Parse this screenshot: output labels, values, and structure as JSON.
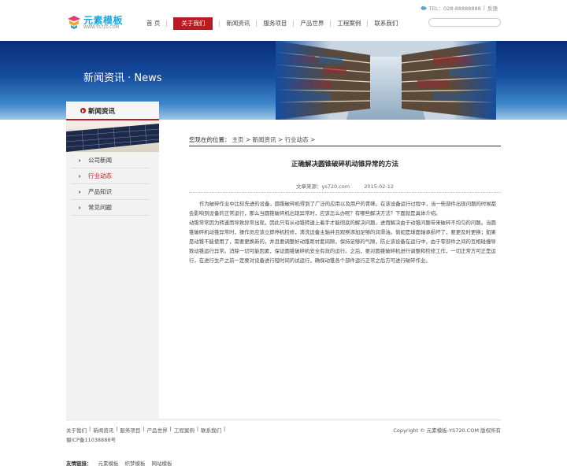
{
  "header": {
    "logo_name": "元素模板",
    "logo_url": "WWW.YS720.COM",
    "tel_text": "TEL：028-88888888",
    "divider": "|",
    "feedback": "反馈",
    "search_placeholder": ""
  },
  "nav": {
    "items": [
      {
        "label": "首 页"
      },
      {
        "label": "关于我们",
        "active": true
      },
      {
        "label": "新闻资讯"
      },
      {
        "label": "服务项目"
      },
      {
        "label": "产品世界"
      },
      {
        "label": "工程案例"
      },
      {
        "label": "联系我们"
      }
    ]
  },
  "banner": {
    "title": "新闻资讯 · News"
  },
  "sidebar": {
    "heading": "新闻资讯",
    "items": [
      {
        "label": "公司新闻"
      },
      {
        "label": "行业动态",
        "active": true
      },
      {
        "label": "产品知识"
      },
      {
        "label": "常见问题"
      }
    ]
  },
  "breadcrumb": {
    "label": "您现在的位置：",
    "path": "主页 > 新闻资讯 > 行业动态 >"
  },
  "article": {
    "title": "正确解决圆锥破碎机动锥异常的方法",
    "source": "文章来源：ys720.com",
    "date": "2015-02-12",
    "para1": "作为破碎作业中比较先进的设备，圆锥破碎机得到了广泛的应用以及用户的青睐。在该设备运行过程中，当一些部件出现问题的时候都会影响到设备的正常运行，那么当圆锥破碎机出现异常时，应该怎么办呢？有哪些解决方法？下面就是具体介绍。",
    "para2": "动锥常常因为转速而导致异常出现，因此只有从动锥转速上着手才能彻底的解决问题，进而解决由于动锥问题带来破碎不均匀的问题。当圆锥破碎机动锥异常时，操作员应该立即停机检修，清洗设备主轴并且观察添加足够的润滑油。倘如是球面轴承损坏了，要更及时更换；如果是动锥不能使用了，需要更换新的，并且要调整好动锥距衬套间隙，保持足够的气隙，防止该设备在运行中，由于零部件之间的互相碰撞导致动锥运行异常。消除一切可能因素，保证圆锥破碎机安全有效的运行。之后，要对圆锥破碎机进行调整和检修工作，一切正常方可正是运行，在进行生产之前一定要对设备进行短时间的试运行，确保动锥各个部件运行正常之后方可进行破碎作业。"
  },
  "footer": {
    "links": [
      "关于我们",
      "新闻资讯",
      "服务项目",
      "产品世界",
      "工程案例",
      "联系我们"
    ],
    "sep": "|",
    "icp": "蜀ICP备11038888号",
    "copyright": "Copyright © 元素模板-YS720.COM 版权所有",
    "friend_label": "友情链接：",
    "friend_links": [
      "元素模板",
      "织梦模板",
      "网站模板"
    ]
  },
  "colors": {
    "accent": "#b81c22",
    "banner_dark": "#0a2e7a",
    "logo_blue": "#1ea5d9"
  }
}
